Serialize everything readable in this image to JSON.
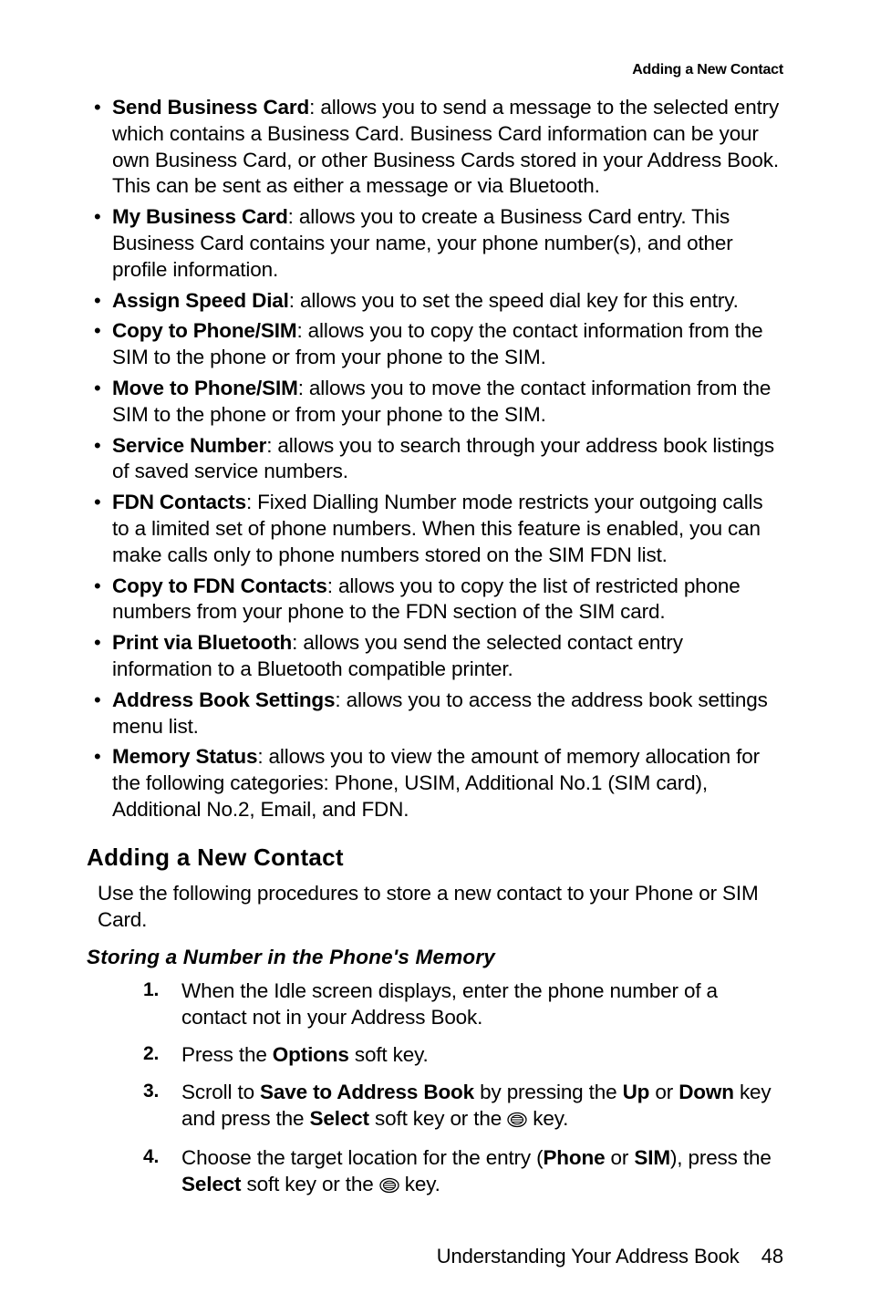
{
  "header": {
    "running_title": "Adding a New Contact"
  },
  "bullets": [
    {
      "term": "Send Business Card",
      "desc": ": allows you to send a message to the selected entry which contains a Business Card. Business Card information can be your own Business Card, or other Business Cards stored in your Address Book. This can be sent as either a message or via Bluetooth."
    },
    {
      "term": "My Business Card",
      "desc": ": allows you to create a Business Card entry. This Business Card contains your name, your phone number(s), and other profile information."
    },
    {
      "term": "Assign Speed Dial",
      "desc": ": allows you to set the speed dial key for this entry."
    },
    {
      "term": "Copy to Phone/SIM",
      "desc": ": allows you to copy the contact information from the SIM to the phone or from your phone to the SIM."
    },
    {
      "term": "Move to Phone/SIM",
      "desc": ": allows you to move the contact information from the SIM to the phone or from your phone to the SIM."
    },
    {
      "term": "Service Number",
      "desc": ": allows you to search through your address book listings of saved service numbers."
    },
    {
      "term": "FDN Contacts",
      "desc": ": Fixed Dialling Number mode restricts your outgoing calls to a limited set of phone numbers. When this feature is enabled, you can make calls only to phone numbers stored on the SIM FDN list."
    },
    {
      "term": "Copy to FDN Contacts",
      "desc": ": allows you to copy the list of restricted phone numbers from your phone to the FDN section of the SIM card."
    },
    {
      "term": "Print via Bluetooth",
      "desc": ": allows you send the selected contact entry information to a Bluetooth compatible printer."
    },
    {
      "term": "Address Book Settings",
      "desc": ": allows you to access the address book settings menu list."
    },
    {
      "term": "Memory Status",
      "desc": ": allows you to view the amount of memory allocation for the following categories: Phone, USIM, Additional No.1 (SIM card), Additional No.2, Email, and FDN."
    }
  ],
  "section": {
    "title": "Adding a New Contact",
    "intro": "Use the following procedures to store a new contact to your Phone or SIM Card."
  },
  "subsection": {
    "title": "Storing a Number in the Phone's Memory"
  },
  "steps": {
    "s1": "When the Idle screen displays, enter the phone number of a contact not in your Address Book.",
    "s2_pre": "Press the ",
    "s2_b1": "Options",
    "s2_post": " soft key.",
    "s3_pre": "Scroll to ",
    "s3_b1": "Save to Address Book",
    "s3_mid1": " by pressing the ",
    "s3_b2": "Up",
    "s3_mid2": " or ",
    "s3_b3": "Down",
    "s3_mid3": " key and press the ",
    "s3_b4": "Select",
    "s3_mid4": " soft key or the ",
    "s3_post": " key.",
    "s4_pre": "Choose the target location for the entry (",
    "s4_b1": "Phone",
    "s4_mid1": " or ",
    "s4_b2": "SIM",
    "s4_mid2": "), press the ",
    "s4_b3": "Select",
    "s4_mid3": " soft key or the ",
    "s4_post": " key."
  },
  "footer": {
    "chapter": "Understanding Your Address Book",
    "page": "48"
  }
}
